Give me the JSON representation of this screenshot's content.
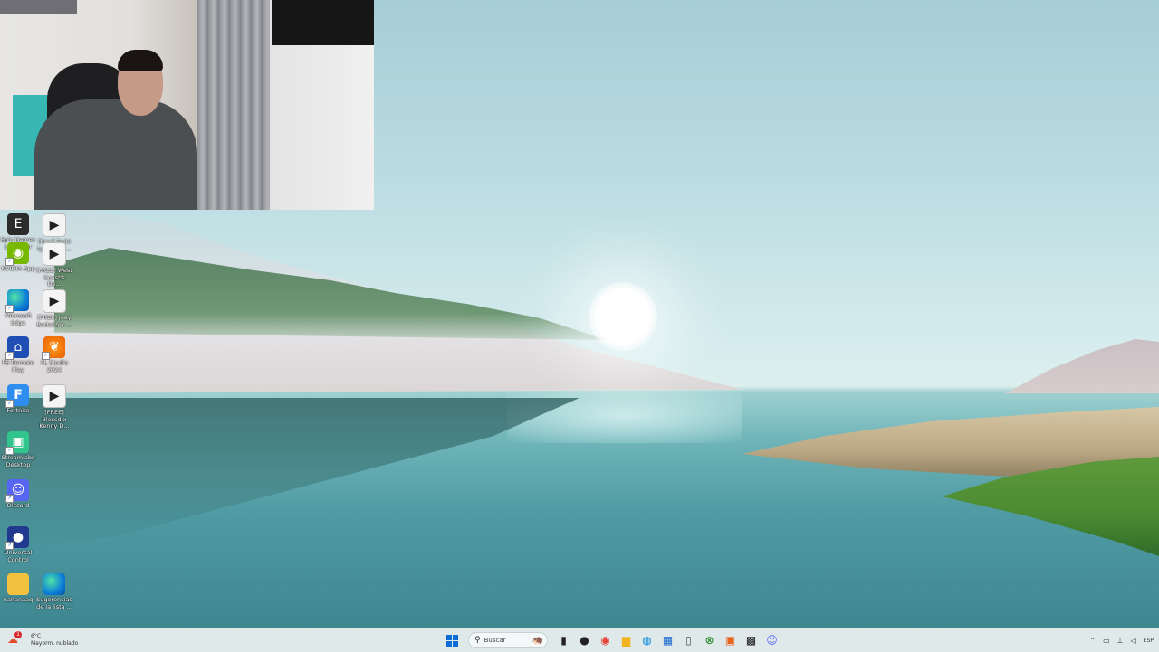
{
  "desktop_icons": [
    {
      "name": "epic-games-launcher-icon",
      "label": "Epic Games Launcher",
      "glyph": "E"
    },
    {
      "name": "audio-file-icon",
      "label": "[free] Tucki type beat...",
      "glyph": "▶"
    },
    {
      "name": "nvidia-app-icon",
      "label": "NVIDIA App",
      "glyph": "◉"
    },
    {
      "name": "audio-file-icon",
      "label": "[FREE] West Coast's De...",
      "glyph": "▶"
    },
    {
      "name": "edge-icon",
      "label": "Microsoft Edge",
      "glyph": ""
    },
    {
      "name": "audio-file-icon",
      "label": "[FREE] Joey BadaSS x ...",
      "glyph": "▶"
    },
    {
      "name": "ps-remote-play-icon",
      "label": "PS Remote Play",
      "glyph": "⌂"
    },
    {
      "name": "fl-studio-icon",
      "label": "FL Studio 2024",
      "glyph": "❦"
    },
    {
      "name": "fortnite-icon",
      "label": "Fortnite",
      "glyph": "F"
    },
    {
      "name": "audio-file-icon",
      "label": "[FREE] Blessd x Kenny D...",
      "glyph": "▶"
    },
    {
      "name": "streamlabs-icon",
      "label": "Streamlabs Desktop",
      "glyph": "▣"
    },
    {
      "name": "discord-icon",
      "label": "Discord",
      "glyph": "☺"
    },
    {
      "name": "universal-control-icon",
      "label": "Universal Control",
      "glyph": "●"
    },
    {
      "name": "folder-icon",
      "label": "nananaaq",
      "glyph": ""
    },
    {
      "name": "edge-icon",
      "label": "Sugerencias de la lista ...",
      "glyph": ""
    }
  ],
  "taskbar": {
    "weather": {
      "badge": "1",
      "temp": "6°C",
      "condition": "Mayorm. nublado"
    },
    "search_placeholder": "Buscar",
    "language": "ESP"
  }
}
